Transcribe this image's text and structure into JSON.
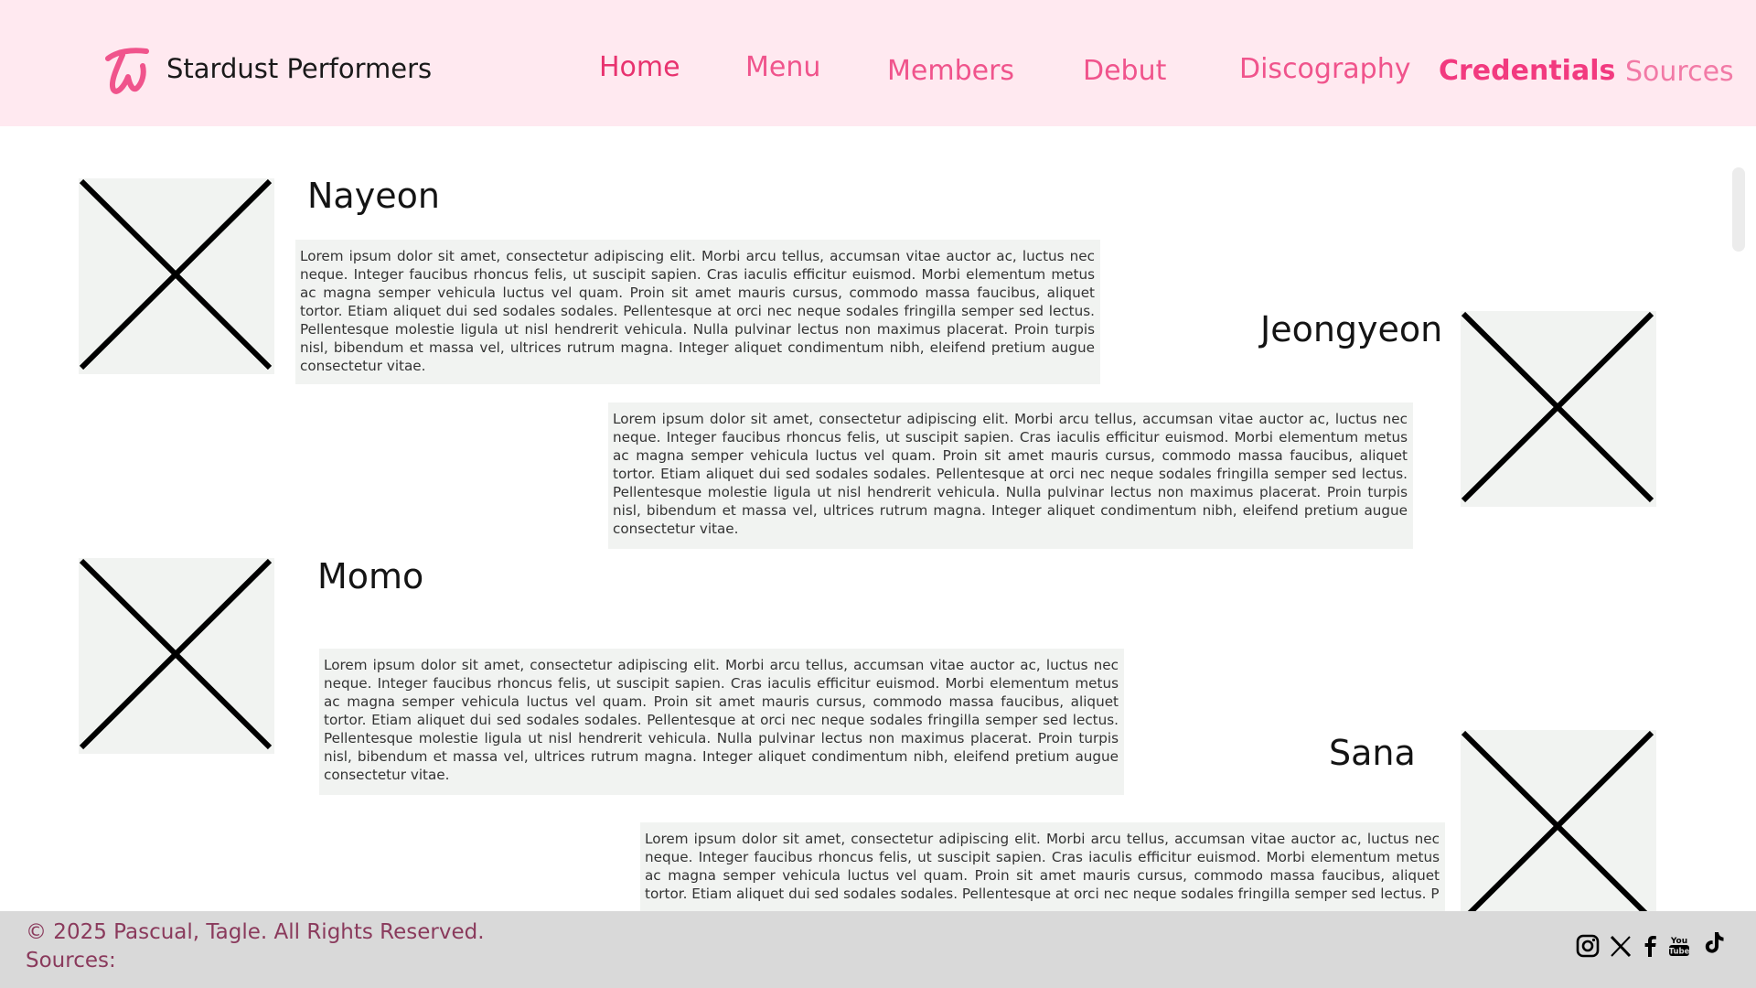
{
  "brand": {
    "name": "Stardust Performers",
    "logo": "tw-logo",
    "accent": "#f0548c"
  },
  "nav": {
    "home": "Home",
    "menu": "Menu",
    "members": "Members",
    "debut": "Debut",
    "discography": "Discography",
    "credentials": "Credentials",
    "sources": "Sources",
    "active": "Credentials"
  },
  "members": [
    {
      "name": "Nayeon",
      "description": "Lorem ipsum dolor sit amet, consectetur adipiscing elit. Morbi arcu tellus, accumsan vitae auctor ac, luctus nec neque. Integer faucibus rhoncus felis, ut suscipit sapien. Cras iaculis efficitur euismod. Morbi elementum metus ac magna semper vehicula luctus vel quam. Proin sit amet mauris cursus, commodo massa faucibus, aliquet tortor. Etiam aliquet dui sed sodales sodales. Pellentesque at orci nec neque sodales fringilla semper sed lectus. Pellentesque molestie ligula ut nisl hendrerit vehicula. Nulla pulvinar lectus non maximus placerat. Proin turpis nisl, bibendum et massa vel, ultrices rutrum magna. Integer aliquet condimentum nibh, eleifend pretium augue consectetur vitae."
    },
    {
      "name": "Jeongyeon",
      "description": "Lorem ipsum dolor sit amet, consectetur adipiscing elit. Morbi arcu tellus, accumsan vitae auctor ac, luctus nec neque. Integer faucibus rhoncus felis, ut suscipit sapien. Cras iaculis efficitur euismod. Morbi elementum metus ac magna semper vehicula luctus vel quam. Proin sit amet mauris cursus, commodo massa faucibus, aliquet tortor. Etiam aliquet dui sed sodales sodales. Pellentesque at orci nec neque sodales fringilla semper sed lectus. Pellentesque molestie ligula ut nisl hendrerit vehicula. Nulla pulvinar lectus non maximus placerat. Proin turpis nisl, bibendum et massa vel, ultrices rutrum magna. Integer aliquet condimentum nibh, eleifend pretium augue consectetur vitae."
    },
    {
      "name": "Momo",
      "description": "Lorem ipsum dolor sit amet, consectetur adipiscing elit. Morbi arcu tellus, accumsan vitae auctor ac, luctus nec neque. Integer faucibus rhoncus felis, ut suscipit sapien. Cras iaculis efficitur euismod. Morbi elementum metus ac magna semper vehicula luctus vel quam. Proin sit amet mauris cursus, commodo massa faucibus, aliquet tortor. Etiam aliquet dui sed sodales sodales. Pellentesque at orci nec neque sodales fringilla semper sed lectus. Pellentesque molestie ligula ut nisl hendrerit vehicula. Nulla pulvinar lectus non maximus placerat. Proin turpis nisl, bibendum et massa vel, ultrices rutrum magna. Integer aliquet condimentum nibh, eleifend pretium augue consectetur vitae."
    },
    {
      "name": "Sana",
      "description": "Lorem ipsum dolor sit amet, consectetur adipiscing elit. Morbi arcu tellus, accumsan vitae auctor ac, luctus nec neque. Integer faucibus rhoncus felis, ut suscipit sapien. Cras iaculis efficitur euismod. Morbi elementum metus ac magna semper vehicula luctus vel quam. Proin sit amet mauris cursus, commodo massa faucibus, aliquet tortor. Etiam aliquet dui sed sodales sodales. Pellentesque at orci nec neque sodales fringilla semper sed lectus. P"
    }
  ],
  "footer": {
    "copyright": "© 2025 Pascual, Tagle. All Rights Reserved.",
    "sources": "Sources:",
    "social": [
      "instagram-icon",
      "x-icon",
      "facebook-icon",
      "youtube-icon",
      "tiktok-icon"
    ]
  },
  "colors": {
    "header_bg": "#ffe9f0",
    "footer_bg": "#d9d9d9",
    "card_bg": "#f1f3f1",
    "footer_text": "#8a3a5c"
  }
}
